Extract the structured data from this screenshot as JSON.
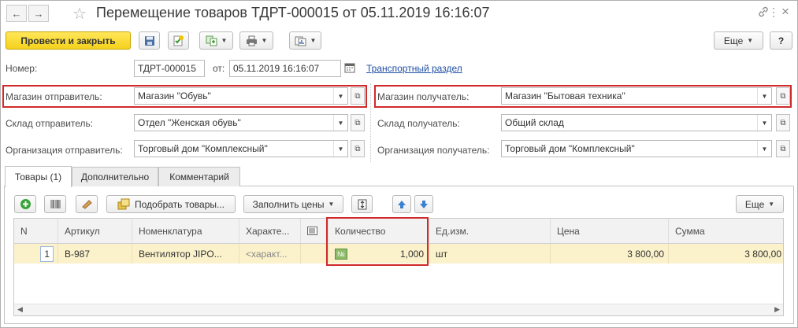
{
  "window": {
    "title": "Перемещение товаров ТДРТ-000015 от 05.11.2019 16:16:07",
    "back_icon": "←",
    "forward_icon": "→",
    "star_icon": "☆",
    "link_icon": "🔗",
    "more_icon": "⋮",
    "close_icon": "×"
  },
  "toolbar": {
    "post_close_label": "Провести и закрыть",
    "more_label": "Еще",
    "help_label": "?"
  },
  "header": {
    "number_label": "Номер:",
    "number_value": "ТДРТ-000015",
    "date_label": "от:",
    "date_value": "05.11.2019 16:16:07",
    "transport_link": "Транспортный раздел"
  },
  "fields": {
    "sender_store_label": "Магазин отправитель:",
    "sender_store_value": "Магазин \"Обувь\"",
    "receiver_store_label": "Магазин получатель:",
    "receiver_store_value": "Магазин \"Бытовая техника\"",
    "sender_warehouse_label": "Склад отправитель:",
    "sender_warehouse_value": "Отдел \"Женская обувь\"",
    "receiver_warehouse_label": "Склад получатель:",
    "receiver_warehouse_value": "Общий склад",
    "sender_org_label": "Организация отправитель:",
    "sender_org_value": "Торговый дом \"Комплексный\"",
    "receiver_org_label": "Организация получатель:",
    "receiver_org_value": "Торговый дом \"Комплексный\""
  },
  "tabs": [
    {
      "label": "Товары (1)"
    },
    {
      "label": "Дополнительно"
    },
    {
      "label": "Комментарий"
    }
  ],
  "table_toolbar": {
    "pick_goods_label": "Подобрать товары...",
    "fill_prices_label": "Заполнить цены",
    "more_label": "Еще"
  },
  "table": {
    "columns": [
      "N",
      "Артикул",
      "Номенклатура",
      "Характе...",
      "",
      "Количество",
      "Ед.изм.",
      "Цена",
      "Сумма"
    ],
    "rows": [
      {
        "n": "1",
        "article": "В-987",
        "nomenclature": "Вентилятор JIPO...",
        "characteristic": "<характ...",
        "qty_badge": "№",
        "quantity": "1,000",
        "unit": "шт",
        "price": "3 800,00",
        "sum": "3 800,00"
      }
    ]
  },
  "colors": {
    "primary_button": "#f5d21c",
    "highlight": "#d02a2a",
    "selected_row": "#fbf2cb",
    "link": "#1f4ea3"
  }
}
